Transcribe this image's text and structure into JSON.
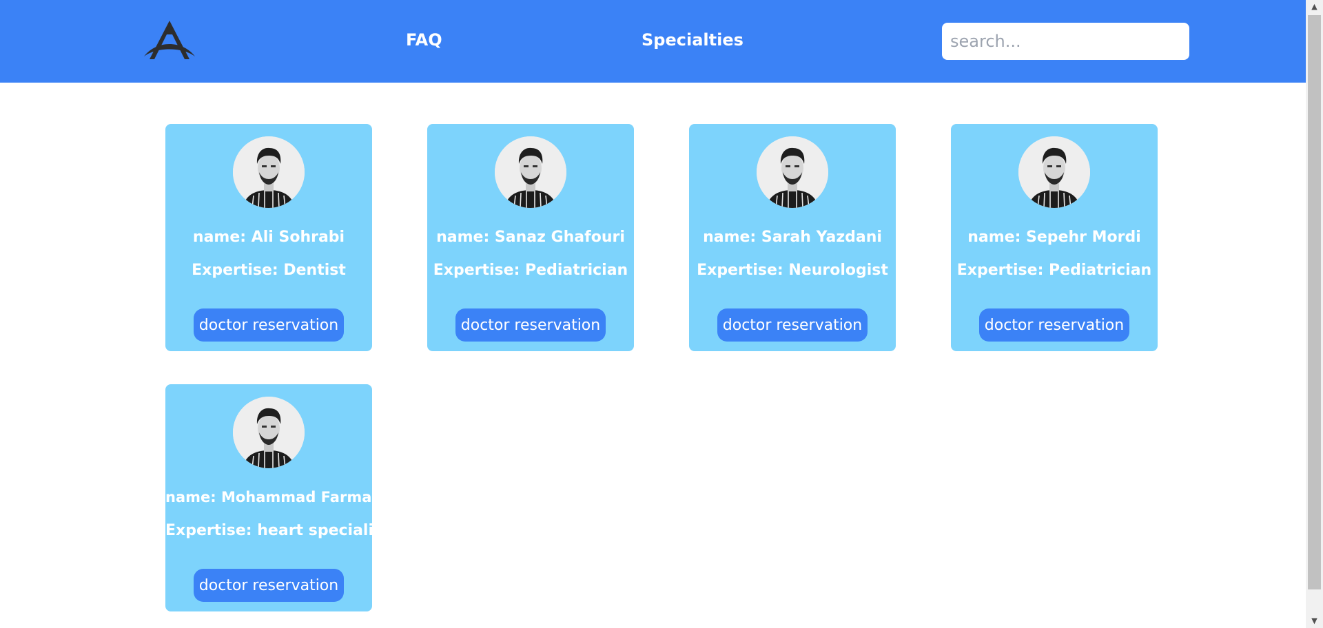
{
  "header": {
    "logo_icon": "logo-a-icon",
    "nav": [
      {
        "label": "FAQ"
      },
      {
        "label": "Specialties"
      }
    ],
    "search": {
      "placeholder": "search...",
      "value": ""
    }
  },
  "doctors": [
    {
      "name": "name: Ali Sohrabi",
      "expertise": "Expertise: Dentist",
      "button": "doctor reservation",
      "avatar_icon": "doctor-avatar-icon"
    },
    {
      "name": "name: Sanaz Ghafouri",
      "expertise": "Expertise: Pediatrician",
      "button": "doctor reservation",
      "avatar_icon": "doctor-avatar-icon"
    },
    {
      "name": "name: Sarah Yazdani",
      "expertise": "Expertise: Neurologist",
      "button": "doctor reservation",
      "avatar_icon": "doctor-avatar-icon"
    },
    {
      "name": "name: Sepehr Mordi",
      "expertise": "Expertise: Pediatrician",
      "button": "doctor reservation",
      "avatar_icon": "doctor-avatar-icon"
    },
    {
      "name": "name: Mohammad Farman",
      "expertise": "Expertise: heart specialist",
      "button": "doctor reservation",
      "avatar_icon": "doctor-avatar-icon"
    }
  ],
  "colors": {
    "header_bg": "#3b82f6",
    "card_bg": "#7dd3fc",
    "button_bg": "#3b82f6",
    "text": "#ffffff"
  }
}
